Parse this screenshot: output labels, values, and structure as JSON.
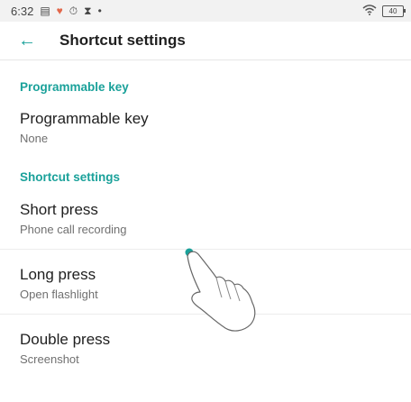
{
  "status": {
    "time": "6:32",
    "battery": "40",
    "icons": [
      "message-icon",
      "heart-icon",
      "timer-icon",
      "hourglass-icon",
      "dot-icon",
      "wifi-icon",
      "battery-icon"
    ]
  },
  "appbar": {
    "title": "Shortcut settings",
    "back_icon": "back-arrow-icon"
  },
  "sections": {
    "programmable": {
      "header": "Programmable key",
      "item": {
        "title": "Programmable key",
        "value": "None"
      }
    },
    "shortcut": {
      "header": "Shortcut settings",
      "short_press": {
        "title": "Short press",
        "value": "Phone call recording"
      },
      "long_press": {
        "title": "Long press",
        "value": "Open flashlight"
      },
      "double_press": {
        "title": "Double press",
        "value": "Screenshot"
      }
    }
  },
  "colors": {
    "accent": "#1aa19a",
    "statusbar": "#f2f2f2",
    "text_primary": "#1f1f1f",
    "text_secondary": "#707070"
  }
}
